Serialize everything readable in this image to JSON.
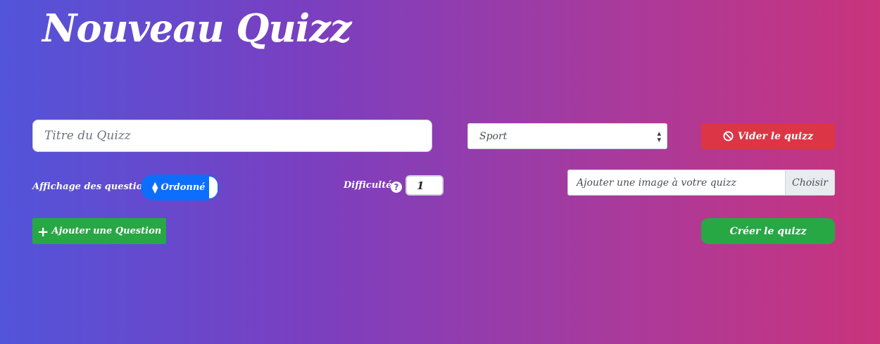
{
  "page": {
    "title": "Nouveau Quizz"
  },
  "form": {
    "title_placeholder": "Titre du Quizz",
    "category_selected": "Sport",
    "clear_label": "Vider le quizz",
    "display_label": "Affichage des questions :",
    "display_mode": "Ordonné",
    "difficulty_label": "Difficulté :",
    "difficulty_value": "1",
    "image_label": "Ajouter une image à votre quizz",
    "image_button": "Choisir",
    "add_question_label": "Ajouter une Question",
    "create_label": "Créer le quizz"
  },
  "icons": {
    "clear": "ban-icon",
    "help": "question-circle-icon",
    "add": "plus-icon",
    "toggle": "sort-icon",
    "select": "chevron-updown-icon"
  },
  "colors": {
    "danger": "#dc3545",
    "success": "#28a745",
    "primary": "#0d6efd",
    "gradient_start": "#5254da",
    "gradient_end": "#c9347c"
  }
}
